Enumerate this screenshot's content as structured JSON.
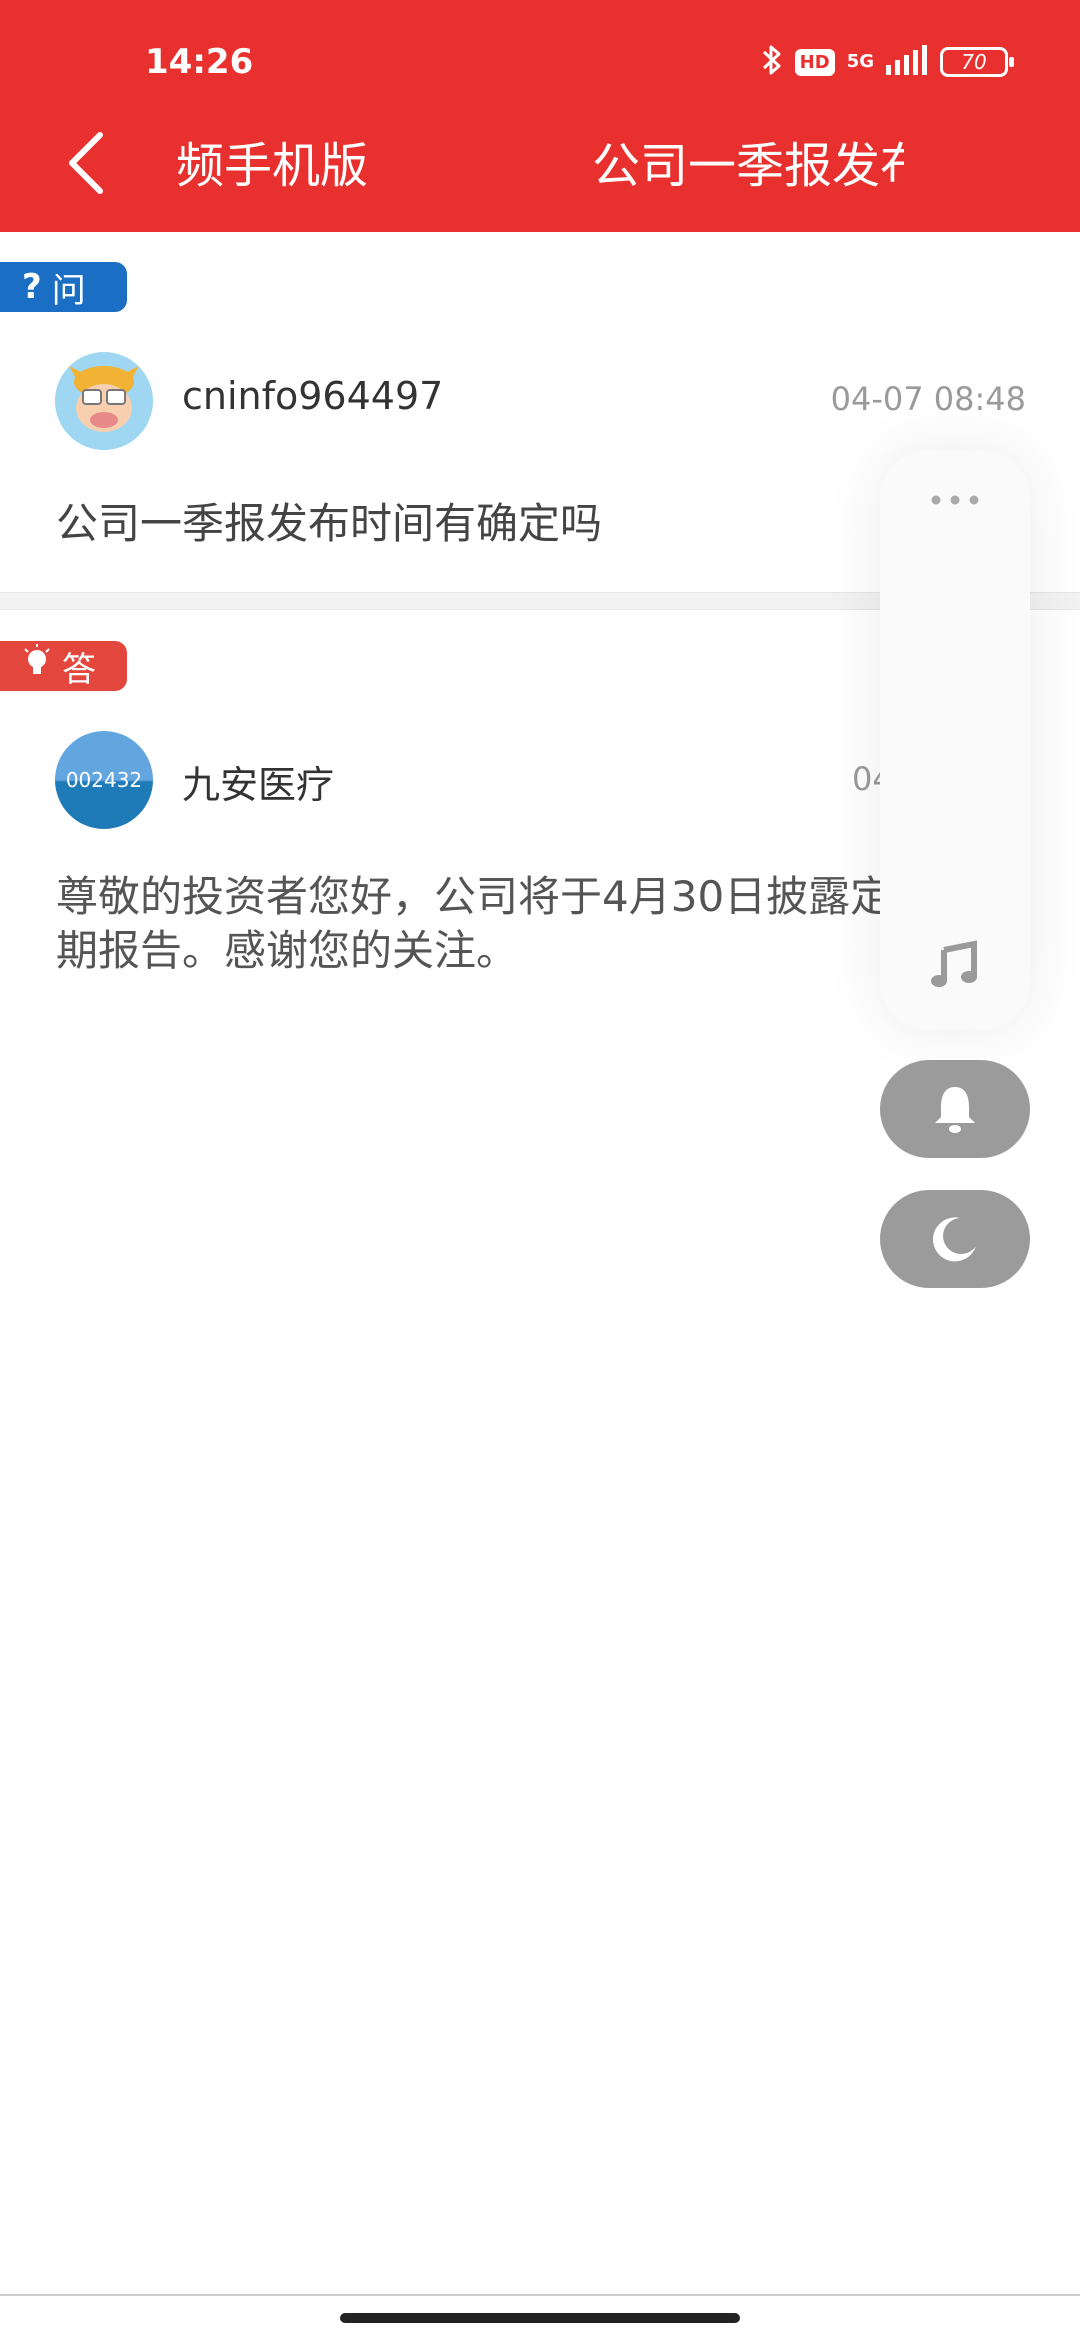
{
  "status_bar": {
    "time": "14:26",
    "hd_label": "HD",
    "network_label": "5G",
    "battery_level": "70"
  },
  "header": {
    "title_left": "频手机版",
    "title_right": "公司一季报发布",
    "background_color": "#e8312f"
  },
  "question": {
    "tag_icon": "?",
    "tag_label": "问",
    "username": "cninfo964497",
    "timestamp": "04-07 08:48",
    "text": "公司一季报发布时间有确定吗"
  },
  "answer": {
    "tag_label": "答",
    "company_code": "002432",
    "company_name": "九安医疗",
    "timestamp_partial": "04",
    "text": "尊敬的投资者您好，公司将于4月30日披露定期报告。感谢您的关注。"
  },
  "float_panel": {
    "icons": [
      "more-icon",
      "music-icon",
      "bell-icon",
      "moon-icon"
    ]
  }
}
